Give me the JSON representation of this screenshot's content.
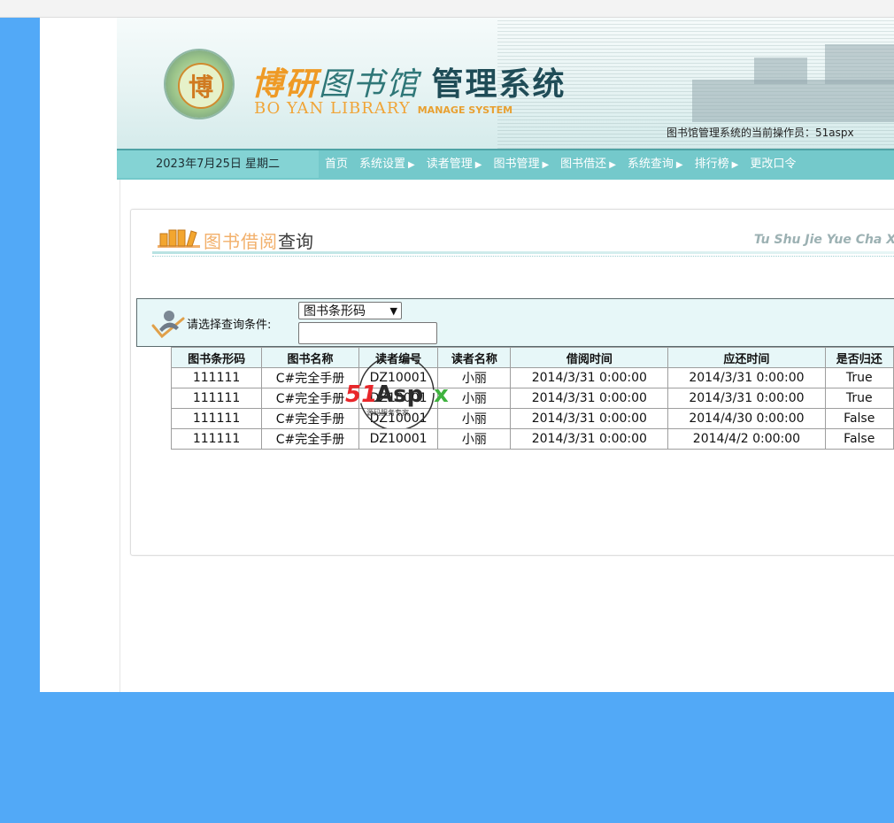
{
  "header": {
    "logo_char": "博",
    "title_part1": "博研",
    "title_part2": "图书馆",
    "title_part3": "管理系统",
    "title_en_main": "BO YAN LIBRARY",
    "title_en_sub": "MANAGE SYSTEM",
    "operator_text": "图书馆管理系统的当前操作员：51aspx"
  },
  "nav": {
    "date": "2023年7月25日  星期二",
    "items": [
      {
        "label": "首页",
        "has_arrow": false
      },
      {
        "label": "系统设置",
        "has_arrow": true
      },
      {
        "label": "读者管理",
        "has_arrow": true
      },
      {
        "label": "图书管理",
        "has_arrow": true
      },
      {
        "label": "图书借还",
        "has_arrow": true
      },
      {
        "label": "系统查询",
        "has_arrow": true
      },
      {
        "label": "排行榜",
        "has_arrow": true
      },
      {
        "label": "更改口令",
        "has_arrow": false
      }
    ]
  },
  "panel": {
    "title_light": "图书借阅",
    "title_dark": "查询",
    "title_en": "Tu Shu Jie Yue Cha Xun"
  },
  "search": {
    "label": "请选择查询条件:",
    "selected_option": "图书条形码",
    "input_value": ""
  },
  "table": {
    "columns": [
      "图书条形码",
      "图书名称",
      "读者编号",
      "读者名称",
      "借阅时间",
      "应还时间",
      "是否归还"
    ],
    "rows": [
      [
        "111111",
        "C#完全手册",
        "DZ10001",
        "小丽",
        "2014/3/31 0:00:00",
        "2014/3/31 0:00:00",
        "True"
      ],
      [
        "111111",
        "C#完全手册",
        "DZ10001",
        "小丽",
        "2014/3/31 0:00:00",
        "2014/3/31 0:00:00",
        "True"
      ],
      [
        "111111",
        "C#完全手册",
        "DZ10001",
        "小丽",
        "2014/3/31 0:00:00",
        "2014/4/30 0:00:00",
        "False"
      ],
      [
        "111111",
        "C#完全手册",
        "DZ10001",
        "小丽",
        "2014/3/31 0:00:00",
        "2014/4/2 0:00:00",
        "False"
      ]
    ]
  },
  "watermark": {
    "brand": "51Aspx",
    "tagline": "源码服务专家"
  },
  "colors": {
    "page_background": "#52a9f7",
    "nav_background": "#74c9cb",
    "accent_orange": "#ef9a25",
    "table_header_bg": "#e7f7f8"
  }
}
